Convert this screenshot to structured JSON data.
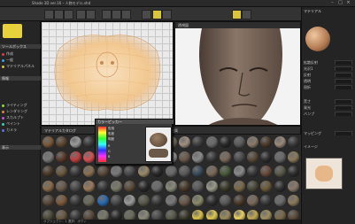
{
  "window": {
    "title": "Shade 3D  ver.16  –  人物モデル.shd",
    "controls": [
      "–",
      "□",
      "×"
    ]
  },
  "toolbar": {
    "buttons": [
      "new",
      "open",
      "save",
      "undo",
      "redo",
      "move",
      "rotate",
      "scale",
      "uv",
      "render",
      "paint",
      "select",
      "options"
    ],
    "active": "render"
  },
  "left_panel": {
    "header": "ツールボックス",
    "items": [
      {
        "label": "作成",
        "color": "#d84040"
      },
      {
        "label": "一般",
        "color": "#40a0d8"
      },
      {
        "label": "マテリアルパネル",
        "color": "#d8c040"
      },
      {
        "label": "ライティング",
        "color": "#8fd84a"
      },
      {
        "label": "レンダリング",
        "color": "#d88a40"
      },
      {
        "label": "スカルプト",
        "color": "#c050d0"
      },
      {
        "label": "ペイント",
        "color": "#40d0b0"
      },
      {
        "label": "カメラ",
        "color": "#6070e0"
      }
    ],
    "section2": "情報",
    "section3": "表示"
  },
  "uv_editor": {
    "title": "UV"
  },
  "viewport": {
    "label": "透視図"
  },
  "right_panel": {
    "title": "マテリアル",
    "rows": [
      "拡散反射",
      "光沢1",
      "反射",
      "透明",
      "屈折",
      "荒さ",
      "発光",
      "バンプ",
      "マッピング",
      "イメージ"
    ]
  },
  "materials": {
    "header_tabs": [
      "マテリアルカタログ",
      "布",
      "革",
      "金属"
    ],
    "colors": [
      "#7a5a3a",
      "#5c4630",
      "#9a9a9a",
      "#3a3a3a",
      "#6d5540",
      "#8a8070",
      "#4a4a4a",
      "#2f2f2f",
      "#5a4a3a",
      "#7a7060",
      "#a09080",
      "#3e3e3e",
      "#6a6a6a",
      "#2a2a2a",
      "#5a5a5a",
      "#8a7a6a",
      "#4a3a2a",
      "#9a8a7a",
      "#3a3a3a",
      "#7a7a7a",
      "#5a3a2a",
      "#c04040",
      "#d85050",
      "#e06060",
      "#4a4a4a",
      "#2a2a2a",
      "#3a6ad8",
      "#5a5a5a",
      "#9a9a9a",
      "#6a5a4a",
      "#8a8a8a",
      "#3a3a3a",
      "#7a6a5a",
      "#4a4a4a",
      "#5a4a3a",
      "#2f2f2f",
      "#6a6a6a",
      "#8a7a5a",
      "#4a3a2a",
      "#6a5a40",
      "#3a3a3a",
      "#8a7050",
      "#5a4a3a",
      "#7a7a7a",
      "#4a4a4a",
      "#9a8a6a",
      "#2a2a2a",
      "#6a6a6a",
      "#5a5a5a",
      "#3a4a5a",
      "#7a6a5a",
      "#4a5a3a",
      "#8a8a8a",
      "#3a3a3a",
      "#6a4a3a",
      "#5a5a4a",
      "#2f2f2f",
      "#8a6a4a",
      "#6a5a4a",
      "#4a4a4a",
      "#9a7a5a",
      "#3a3a3a",
      "#7a7a6a",
      "#5a4a3a",
      "#2a2a2a",
      "#6a6a6a",
      "#8a8a7a",
      "#4a3a2a",
      "#5a5a5a",
      "#9a9a8a",
      "#3a3a2a",
      "#7a6a4a",
      "#4a4a3a",
      "#6a5a3a",
      "#2f2f2f",
      "#8a7a6a",
      "#5a4a3a",
      "#7a5a3a",
      "#3a3a3a",
      "#6a6a5a",
      "#2a6ab0",
      "#4a4a4a",
      "#9a9a9a",
      "#5a5a4a",
      "#3a3a3a",
      "#7a7a7a",
      "#6a5a4a",
      "#8a8a6a",
      "#2f2f2f",
      "#5a5a5a",
      "#4a3a2a",
      "#7a6a5a",
      "#3a3a3a",
      "#6a6a6a",
      "#8a7a5a",
      "#4a4a3a",
      "#6a5a40",
      "#3a3a3a",
      "#5a4a3a",
      "#7a7a6a",
      "#2a2a2a",
      "#6a6a5a",
      "#8a8a7a",
      "#4a4a4a",
      "#5a5a4a",
      "#3a3a2a",
      "#d8c048",
      "#e0c850",
      "#9a8a5a",
      "#e8d060",
      "#c0a850",
      "#a09060",
      "#7a6a4a",
      "#5a4a3a"
    ]
  },
  "dialog": {
    "title": "カラーピッカー",
    "rows": [
      "色相",
      "彩度",
      "明度",
      "R",
      "G",
      "B"
    ]
  },
  "status": {
    "text": "オブジェクト：1  選択：ボディ"
  }
}
